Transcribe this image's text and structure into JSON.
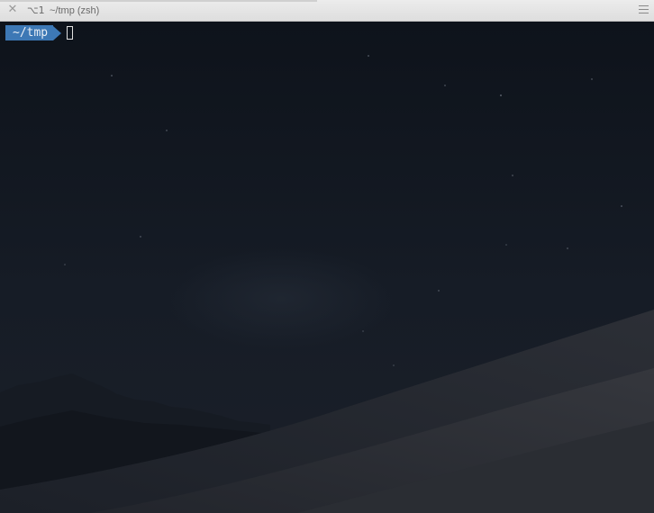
{
  "tab": {
    "close_glyph": "✕",
    "shortcut": "⌥1",
    "title": "~/tmp (zsh)"
  },
  "terminal": {
    "prompt_path": "~/tmp",
    "prompt_color": "#3d78b5",
    "background_color": "#0f141c"
  }
}
